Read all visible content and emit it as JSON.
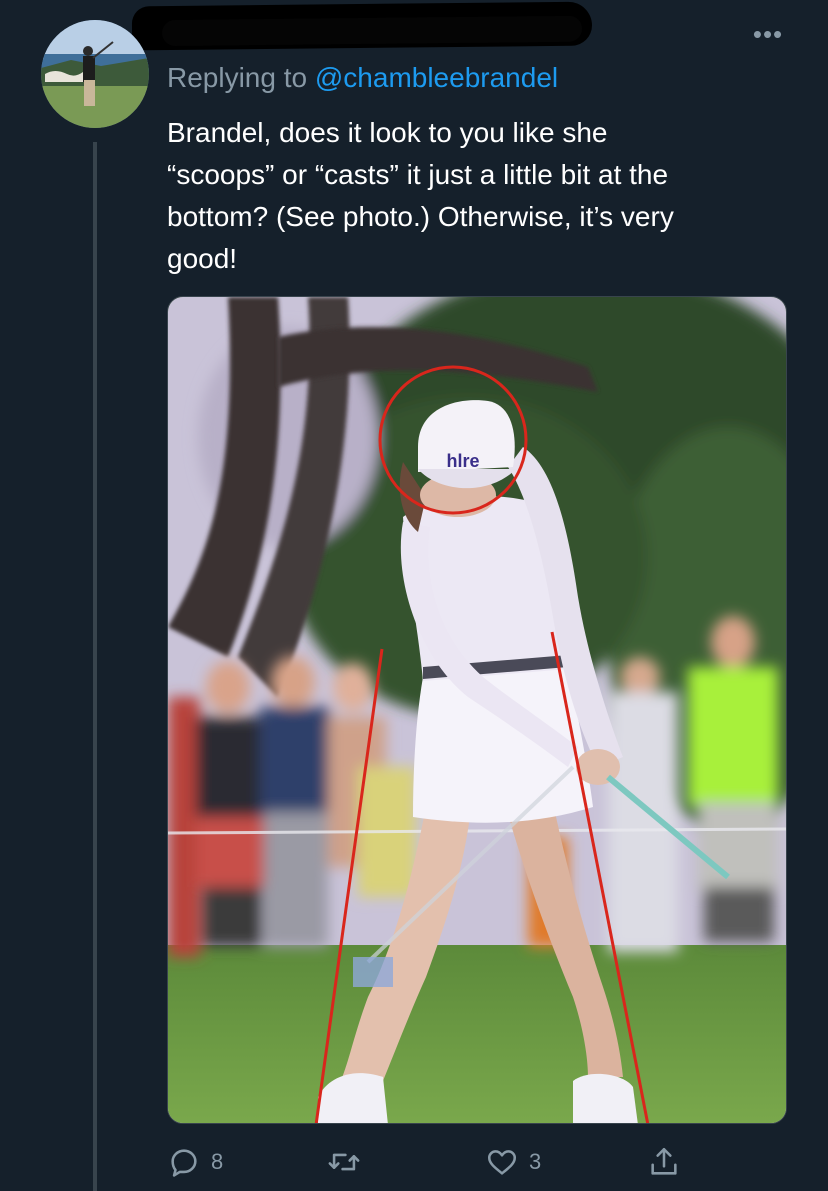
{
  "tweet": {
    "reply_prefix": "Replying to ",
    "reply_handle": "@chambleebrandel",
    "text_lines": [
      "Brandel, does it look to you like she",
      "“scoops” or “casts” it just a little bit at the",
      "bottom? (See photo.) Otherwise, it’s very",
      "good!"
    ],
    "photo_cap_text": "hlre",
    "actions": {
      "reply_count": "8",
      "retweet_count": "",
      "like_count": "3"
    }
  },
  "icons": {
    "more": "more-horizontal-icon",
    "reply": "reply-bubble-icon",
    "retweet": "retweet-icon",
    "like": "heart-icon",
    "share": "share-icon"
  },
  "colors": {
    "background": "#15202b",
    "link": "#1d9bf0",
    "muted": "#8899a6",
    "thread_line": "#38444d",
    "annotation_red": "#d9261c"
  }
}
